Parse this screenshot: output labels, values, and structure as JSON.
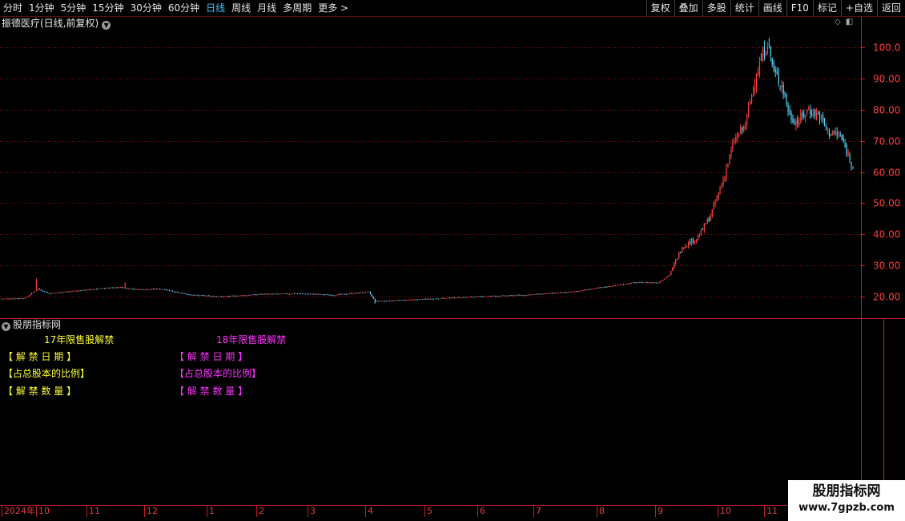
{
  "toolbar": {
    "periods": [
      "分时",
      "1分钟",
      "5分钟",
      "15分钟",
      "30分钟",
      "60分钟",
      "日线",
      "周线",
      "月线",
      "多周期",
      "更多 >"
    ],
    "active_period": "日线",
    "actions": [
      "复权",
      "叠加",
      "多股",
      "统计",
      "画线",
      "F10",
      "标记",
      "+自选",
      "返回"
    ]
  },
  "chart": {
    "title": "振德医疗(日线,前复权)",
    "title_caret_icon": "chevron-down-icon",
    "top_right_icons": [
      "diamond-icon",
      "panel-toggle-icon"
    ],
    "up_color": "#ff4040",
    "down_color": "#4fd8ff",
    "axis_color": "#c81e1e"
  },
  "chart_data": {
    "type": "candlestick",
    "y_ticks": [
      "100.0",
      "90.00",
      "80.00",
      "70.00",
      "60.00",
      "50.00",
      "40.00",
      "30.00",
      "20.00"
    ],
    "ylim": [
      15,
      105
    ],
    "x_tick_labels": [
      "2024年",
      "10",
      "11",
      "12",
      "1",
      "2",
      "3",
      "4",
      "5",
      "6",
      "7",
      "8",
      "9",
      "10",
      "11"
    ],
    "grid": true,
    "waypoints": [
      {
        "d": 0,
        "p": 19.3
      },
      {
        "d": 15,
        "p": 19.5
      },
      {
        "d": 20,
        "p": 21.5
      },
      {
        "d": 23,
        "p": 22.5
      },
      {
        "d": 30,
        "p": 21.0
      },
      {
        "d": 60,
        "p": 22.5
      },
      {
        "d": 75,
        "p": 23.0
      },
      {
        "d": 85,
        "p": 22.3
      },
      {
        "d": 100,
        "p": 22.5
      },
      {
        "d": 120,
        "p": 20.5
      },
      {
        "d": 140,
        "p": 20.0
      },
      {
        "d": 165,
        "p": 20.8
      },
      {
        "d": 190,
        "p": 21.0
      },
      {
        "d": 210,
        "p": 20.5
      },
      {
        "d": 232,
        "p": 21.5
      },
      {
        "d": 236,
        "p": 18.5
      },
      {
        "d": 260,
        "p": 19.0
      },
      {
        "d": 280,
        "p": 19.5
      },
      {
        "d": 300,
        "p": 20.0
      },
      {
        "d": 330,
        "p": 20.5
      },
      {
        "d": 345,
        "p": 21.0
      },
      {
        "d": 360,
        "p": 21.5
      },
      {
        "d": 380,
        "p": 23.0
      },
      {
        "d": 400,
        "p": 24.5
      },
      {
        "d": 415,
        "p": 24.5
      },
      {
        "d": 422,
        "p": 27.0
      },
      {
        "d": 430,
        "p": 36.0
      },
      {
        "d": 440,
        "p": 39.0
      },
      {
        "d": 448,
        "p": 46.0
      },
      {
        "d": 455,
        "p": 56.0
      },
      {
        "d": 463,
        "p": 70.0
      },
      {
        "d": 470,
        "p": 75.0
      },
      {
        "d": 476,
        "p": 90.0
      },
      {
        "d": 484,
        "p": 102.0
      },
      {
        "d": 488,
        "p": 92.0
      },
      {
        "d": 493,
        "p": 88.0
      },
      {
        "d": 498,
        "p": 78.0
      },
      {
        "d": 503,
        "p": 76.0
      },
      {
        "d": 510,
        "p": 80.0
      },
      {
        "d": 517,
        "p": 78.0
      },
      {
        "d": 522,
        "p": 73.0
      },
      {
        "d": 530,
        "p": 71.5
      },
      {
        "d": 538,
        "p": 62.0
      }
    ],
    "markers": [
      {
        "d": 22,
        "p": 25.8,
        "dir": "up"
      },
      {
        "d": 78,
        "p": 24.5,
        "dir": "up"
      },
      {
        "d": 236,
        "p": 17.8,
        "dir": "down"
      }
    ]
  },
  "indicator": {
    "header": "股朋指标网",
    "header_icon": "chevron-down-icon",
    "col1_title": "17年限售股解禁",
    "col2_title": "18年限售股解禁",
    "row1": "【 解 禁 日 期 】",
    "row2": "【占总股本的比例】",
    "row3": "【 解 禁 数 量 】"
  },
  "watermark": {
    "line1": "股朋指标网",
    "line2": "www.7gpzb.com"
  }
}
